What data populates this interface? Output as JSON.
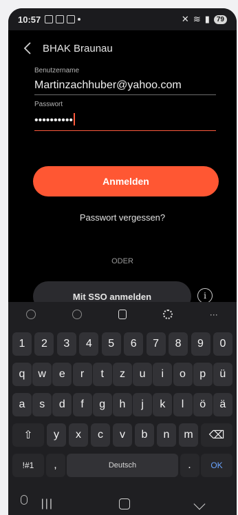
{
  "status_bar": {
    "time": "10:57",
    "battery": "79"
  },
  "header": {
    "title": "BHAK Braunau"
  },
  "form": {
    "username_label": "Benutzername",
    "username_value": "Martinzachhuber@yahoo.com",
    "password_label": "Passwort",
    "password_value": "••••••••••"
  },
  "actions": {
    "login": "Anmelden",
    "forgot": "Passwort vergessen?",
    "or": "ODER",
    "sso": "Mit SSO anmelden",
    "info": "i"
  },
  "keyboard": {
    "toolbar_more": "···",
    "numbers": [
      "1",
      "2",
      "3",
      "4",
      "5",
      "6",
      "7",
      "8",
      "9",
      "0"
    ],
    "row1": [
      "q",
      "w",
      "e",
      "r",
      "t",
      "z",
      "u",
      "i",
      "o",
      "p",
      "ü"
    ],
    "row2": [
      "a",
      "s",
      "d",
      "f",
      "g",
      "h",
      "j",
      "k",
      "l",
      "ö",
      "ä"
    ],
    "row3": [
      "y",
      "x",
      "c",
      "v",
      "b",
      "n",
      "m"
    ],
    "shift": "⇧",
    "backspace": "⌫",
    "symbols": "!#1",
    "comma": ",",
    "space_label": "Deutsch",
    "period": ".",
    "ok": "OK"
  },
  "colors": {
    "accent": "#ff5733",
    "error_line": "#ff5a3d",
    "key_bg": "#323236"
  }
}
